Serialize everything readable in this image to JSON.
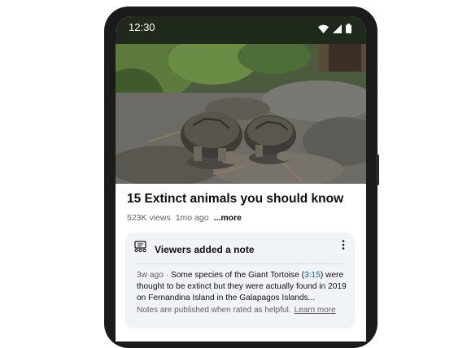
{
  "status_bar": {
    "time": "12:30",
    "icons": [
      "wifi-icon",
      "signal-icon",
      "battery-icon"
    ]
  },
  "video": {
    "title": "15 Extinct animals you should know",
    "views": "523K views",
    "age": "1mo ago",
    "more_label": "...more"
  },
  "note_card": {
    "heading": "Viewers added a note",
    "note_age": "3w ago",
    "separator": "·",
    "text_before": "Some species of the Giant Tortoise (",
    "timestamp": "3:15",
    "text_after": ") were thought to be extinct but they were actually found in 2019 on Fernandina Island in the Galapagos Islands...",
    "footer_text": "Notes are published when rated as helpful.",
    "learn_more_label": "Learn more"
  },
  "colors": {
    "link": "#065fd4",
    "card_bg": "#f0f4f9",
    "status_bar_bg": "#1f2a1c"
  }
}
